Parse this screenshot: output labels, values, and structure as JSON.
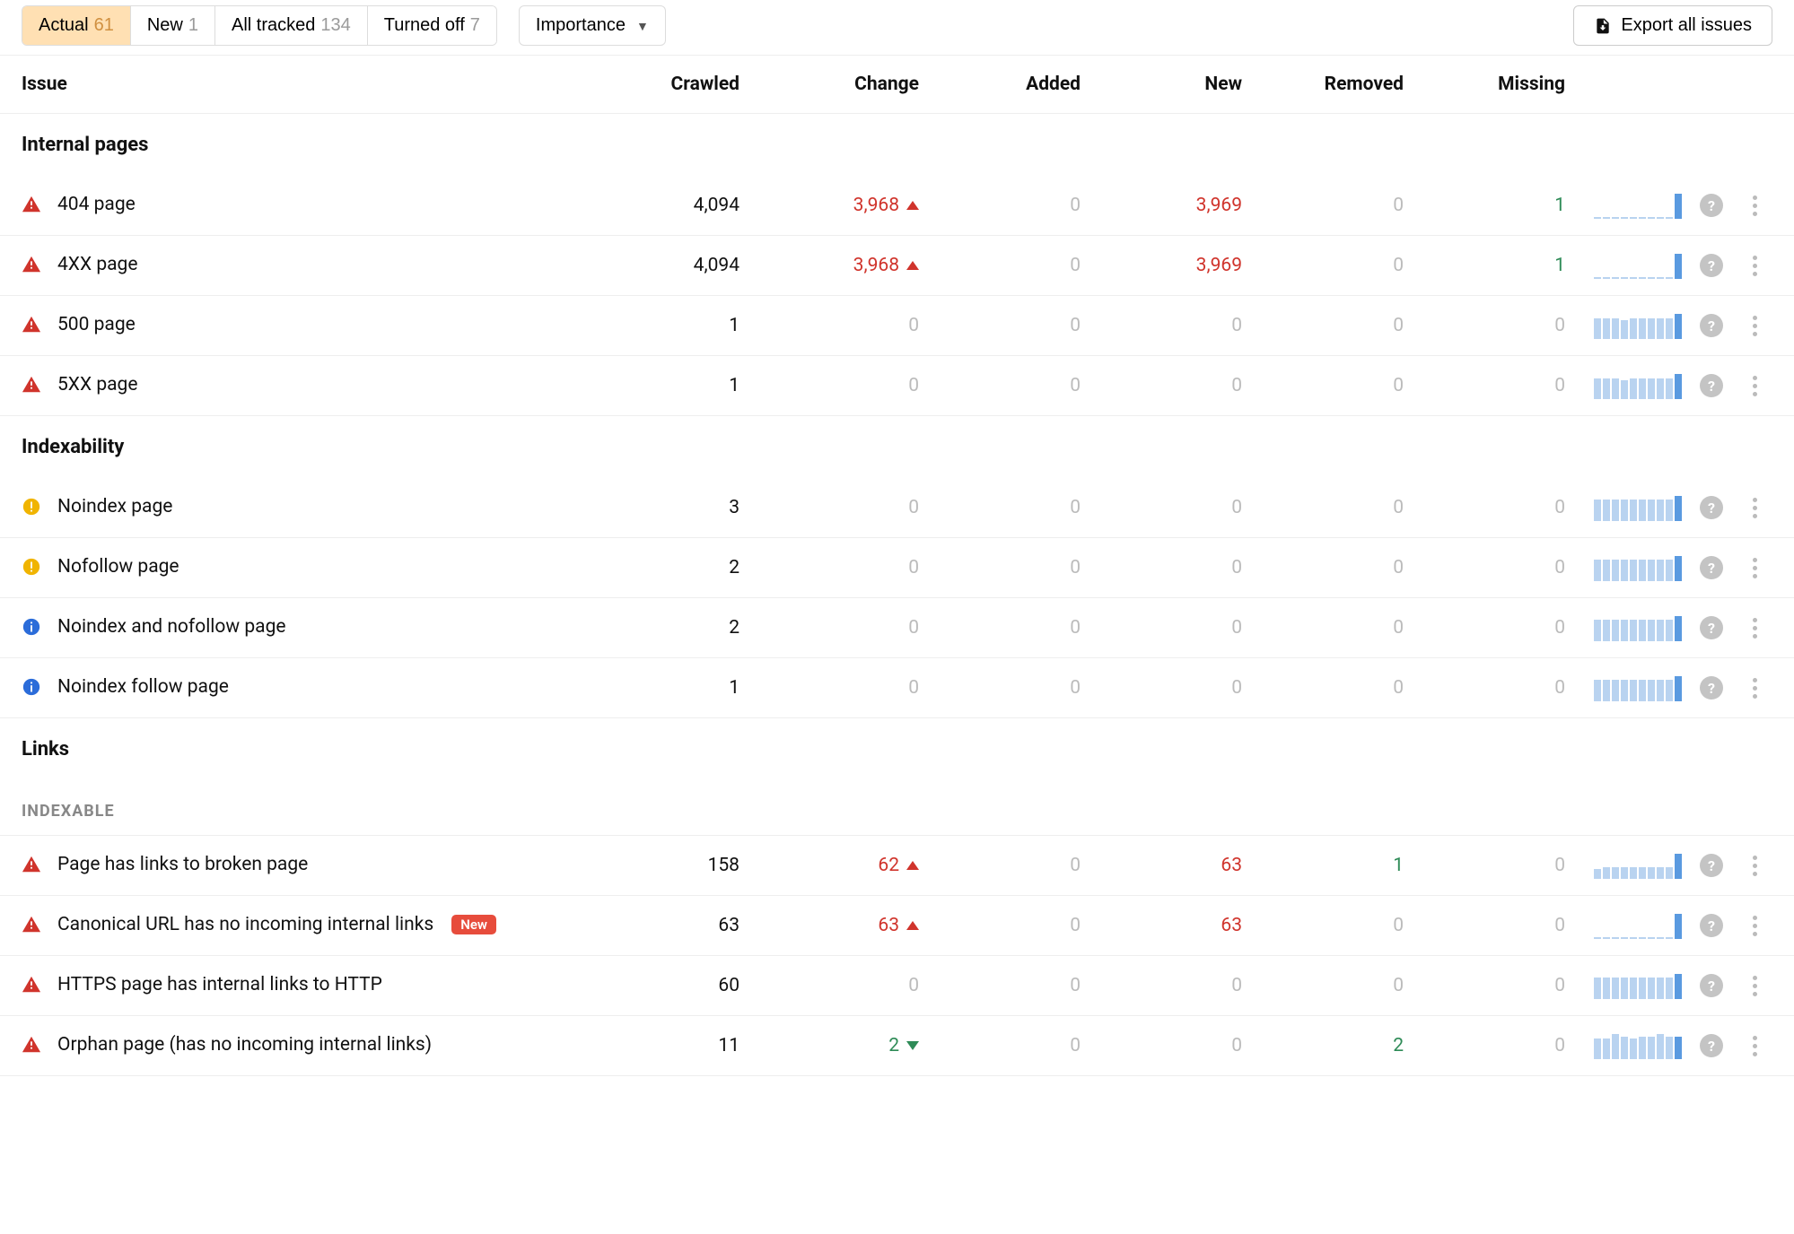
{
  "toolbar": {
    "tabs": [
      {
        "label": "Actual",
        "count": "61",
        "active": true
      },
      {
        "label": "New",
        "count": "1",
        "active": false
      },
      {
        "label": "All tracked",
        "count": "134",
        "active": false
      },
      {
        "label": "Turned off",
        "count": "7",
        "active": false
      }
    ],
    "sort_label": "Importance",
    "export_label": "Export all issues"
  },
  "headers": {
    "issue": "Issue",
    "crawled": "Crawled",
    "change": "Change",
    "added": "Added",
    "new": "New",
    "removed": "Removed",
    "missing": "Missing"
  },
  "sections": [
    {
      "title": "Internal pages",
      "rows": [
        {
          "severity": "critical",
          "label": "404 page",
          "crawled": "4,094",
          "change": "3,968",
          "change_dir": "up",
          "added": "0",
          "new": "3,969",
          "removed": "0",
          "missing": "1",
          "spark": [
            2,
            2,
            2,
            2,
            2,
            2,
            2,
            2,
            2,
            25
          ]
        },
        {
          "severity": "critical",
          "label": "4XX page",
          "crawled": "4,094",
          "change": "3,968",
          "change_dir": "up",
          "added": "0",
          "new": "3,969",
          "removed": "0",
          "missing": "1",
          "spark": [
            2,
            2,
            2,
            2,
            2,
            2,
            2,
            2,
            2,
            25
          ]
        },
        {
          "severity": "critical",
          "label": "500 page",
          "crawled": "1",
          "change": "0",
          "change_dir": "none",
          "added": "0",
          "new": "0",
          "removed": "0",
          "missing": "0",
          "spark": [
            20,
            20,
            20,
            18,
            20,
            20,
            20,
            20,
            20,
            24
          ]
        },
        {
          "severity": "critical",
          "label": "5XX page",
          "crawled": "1",
          "change": "0",
          "change_dir": "none",
          "added": "0",
          "new": "0",
          "removed": "0",
          "missing": "0",
          "spark": [
            20,
            20,
            20,
            18,
            20,
            20,
            20,
            20,
            20,
            24
          ]
        }
      ]
    },
    {
      "title": "Indexability",
      "rows": [
        {
          "severity": "warning",
          "label": "Noindex page",
          "crawled": "3",
          "change": "0",
          "change_dir": "none",
          "added": "0",
          "new": "0",
          "removed": "0",
          "missing": "0",
          "spark": [
            20,
            20,
            20,
            20,
            20,
            20,
            20,
            20,
            20,
            23
          ]
        },
        {
          "severity": "warning",
          "label": "Nofollow page",
          "crawled": "2",
          "change": "0",
          "change_dir": "none",
          "added": "0",
          "new": "0",
          "removed": "0",
          "missing": "0",
          "spark": [
            20,
            20,
            20,
            20,
            20,
            20,
            20,
            20,
            20,
            23
          ]
        },
        {
          "severity": "info",
          "label": "Noindex and nofollow page",
          "crawled": "2",
          "change": "0",
          "change_dir": "none",
          "added": "0",
          "new": "0",
          "removed": "0",
          "missing": "0",
          "spark": [
            20,
            20,
            20,
            20,
            20,
            20,
            20,
            20,
            20,
            23
          ]
        },
        {
          "severity": "info",
          "label": "Noindex follow page",
          "crawled": "1",
          "change": "0",
          "change_dir": "none",
          "added": "0",
          "new": "0",
          "removed": "0",
          "missing": "0",
          "spark": [
            20,
            20,
            20,
            20,
            20,
            20,
            20,
            20,
            20,
            23
          ]
        }
      ]
    },
    {
      "title": "Links",
      "subsections": [
        {
          "title": "Indexable",
          "rows": [
            {
              "severity": "critical",
              "label": "Page has links to broken page",
              "crawled": "158",
              "change": "62",
              "change_dir": "up",
              "added": "0",
              "new": "63",
              "removed": "1",
              "missing": "0",
              "spark": [
                10,
                12,
                12,
                12,
                12,
                12,
                12,
                12,
                12,
                25
              ]
            },
            {
              "severity": "critical",
              "label": "Canonical URL has no incoming internal links",
              "badge": "New",
              "crawled": "63",
              "change": "63",
              "change_dir": "up",
              "added": "0",
              "new": "63",
              "removed": "0",
              "missing": "0",
              "spark": [
                1,
                1,
                1,
                1,
                1,
                1,
                1,
                1,
                1,
                23
              ]
            },
            {
              "severity": "critical",
              "label": "HTTPS page has internal links to HTTP",
              "crawled": "60",
              "change": "0",
              "change_dir": "none",
              "added": "0",
              "new": "0",
              "removed": "0",
              "missing": "0",
              "spark": [
                20,
                20,
                20,
                20,
                20,
                20,
                20,
                20,
                20,
                23
              ]
            },
            {
              "severity": "critical",
              "label": "Orphan page (has no incoming internal links)",
              "crawled": "11",
              "change": "2",
              "change_dir": "down",
              "added": "0",
              "new": "0",
              "removed": "2",
              "missing": "0",
              "spark": [
                18,
                18,
                22,
                20,
                18,
                20,
                20,
                22,
                20,
                20
              ]
            }
          ]
        }
      ]
    }
  ]
}
